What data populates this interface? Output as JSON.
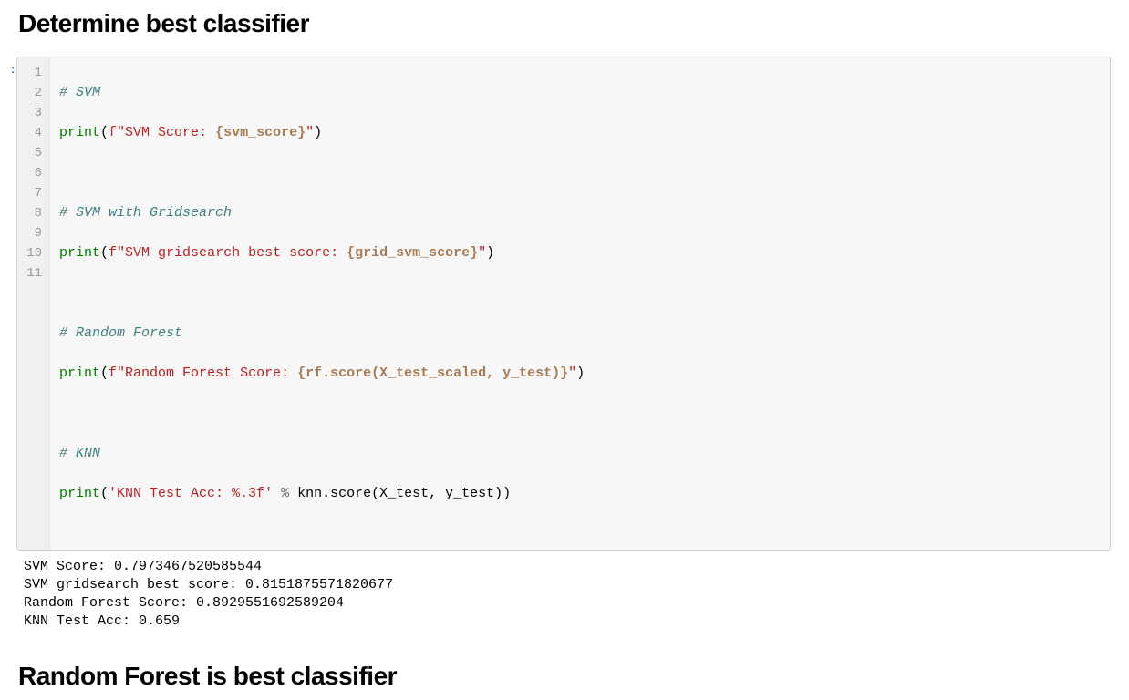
{
  "heading1": "Determine best classifier",
  "heading2": "Random Forest is best classifier",
  "lineNumbers": [
    "1",
    "2",
    "3",
    "4",
    "5",
    "6",
    "7",
    "8",
    "9",
    "10",
    "11"
  ],
  "code": {
    "l1_comment": "# SVM",
    "l2_builtin": "print",
    "l2_open": "(",
    "l2_fprefix": "f",
    "l2_str1": "\"SVM Score: ",
    "l2_interp": "{svm_score}",
    "l2_str2": "\"",
    "l2_close": ")",
    "l4_comment": "# SVM with Gridsearch",
    "l5_builtin": "print",
    "l5_open": "(",
    "l5_fprefix": "f",
    "l5_str1": "\"SVM gridsearch best score: ",
    "l5_interp": "{grid_svm_score}",
    "l5_str2": "\"",
    "l5_close": ")",
    "l7_comment": "# Random Forest",
    "l8_builtin": "print",
    "l8_open": "(",
    "l8_fprefix": "f",
    "l8_str1": "\"Random Forest Score: ",
    "l8_interp": "{rf.score(X_test_scaled, y_test)}",
    "l8_str2": "\"",
    "l8_close": ")",
    "l10_comment": "# KNN",
    "l11_builtin": "print",
    "l11_open": "(",
    "l11_str": "'KNN Test Acc: %.3f'",
    "l11_op": " % ",
    "l11_name": "knn.score(X_test, y_test))"
  },
  "output": {
    "l1": "SVM Score: 0.7973467520585544",
    "l2": "SVM gridsearch best score: 0.8151875571820677",
    "l3": "Random Forest Score: 0.8929551692589204",
    "l4": "KNN Test Acc: 0.659"
  }
}
